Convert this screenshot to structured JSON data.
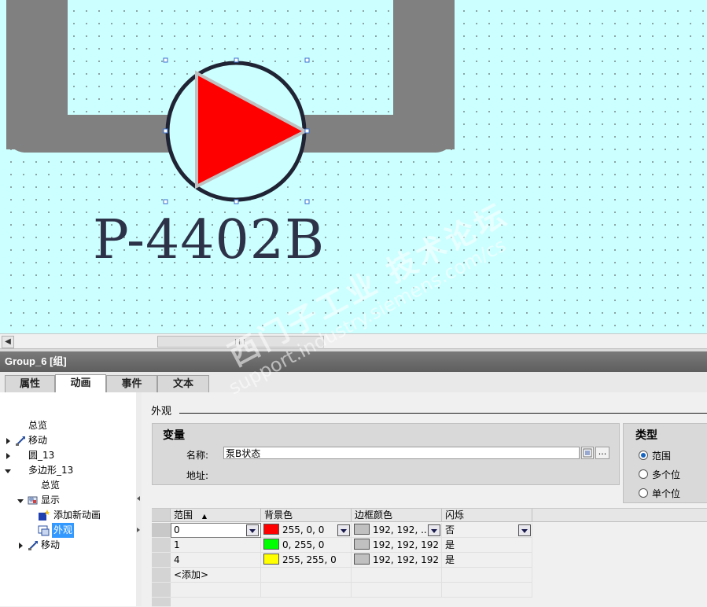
{
  "canvas": {
    "pump_tag": "P-4402B",
    "pump_fill": "#ff0000",
    "pipe_color": "#808080",
    "background": "#ccffff"
  },
  "window": {
    "title": "Group_6 [组]"
  },
  "tabs": [
    {
      "label": "属性",
      "active": false
    },
    {
      "label": "动画",
      "active": true
    },
    {
      "label": "事件",
      "active": false
    },
    {
      "label": "文本",
      "active": false
    }
  ],
  "tree": {
    "items": [
      {
        "label": "总览"
      },
      {
        "label": "移动"
      },
      {
        "label": "圆_13"
      },
      {
        "label": "多边形_13"
      },
      {
        "label": "总览"
      },
      {
        "label": "显示"
      },
      {
        "label": "添加新动画"
      },
      {
        "label": "外观"
      },
      {
        "label": "移动"
      }
    ]
  },
  "main": {
    "section_title": "外观",
    "variable": {
      "header": "变量",
      "name_label": "名称:",
      "name_value": "泵B状态",
      "address_label": "地址:",
      "more_button": "..."
    },
    "type": {
      "header": "类型",
      "options": [
        {
          "label": "范围",
          "selected": true
        },
        {
          "label": "多个位",
          "selected": false
        },
        {
          "label": "单个位",
          "selected": false
        }
      ]
    },
    "table": {
      "columns": [
        "范围",
        "背景色",
        "边框颜色",
        "闪烁"
      ],
      "rows": [
        {
          "range": "0",
          "bg": "255, 0, 0",
          "bg_color": "#ff0000",
          "border": "192, 192, ...",
          "border_color": "#c0c0c0",
          "flash": "否"
        },
        {
          "range": "1",
          "bg": "0, 255, 0",
          "bg_color": "#00ff00",
          "border": "192, 192, 192",
          "border_color": "#c0c0c0",
          "flash": "是"
        },
        {
          "range": "4",
          "bg": "255, 255, 0",
          "bg_color": "#ffff00",
          "border": "192, 192, 192",
          "border_color": "#c0c0c0",
          "flash": "是"
        }
      ],
      "add_row": "<添加>"
    }
  },
  "watermark": {
    "line1": "西门子工业 技术论坛",
    "line2": "support.industry.siemens.com/cs"
  }
}
